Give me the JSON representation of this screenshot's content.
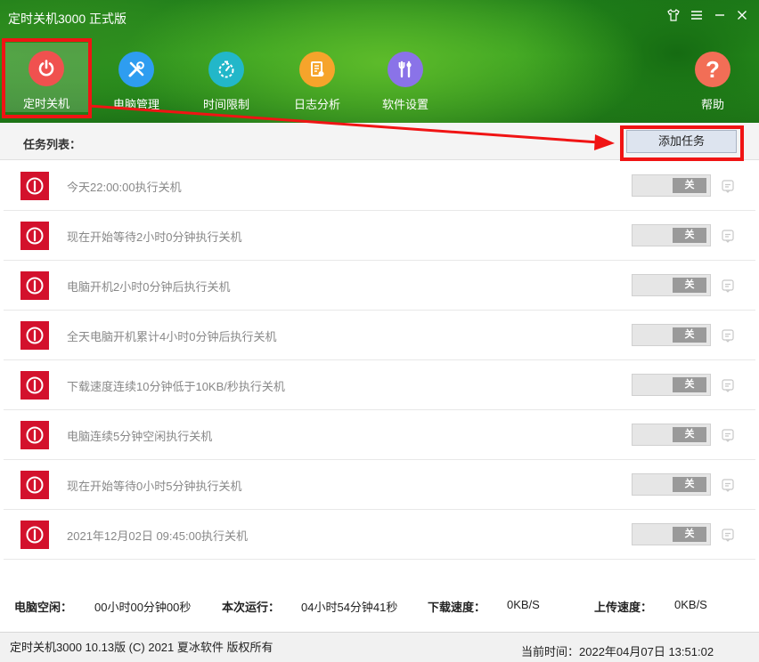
{
  "window": {
    "title": "定时关机3000 正式版",
    "controls": [
      "shirt-icon",
      "menu-icon",
      "minimize-icon",
      "close-icon"
    ]
  },
  "nav": {
    "items": [
      {
        "label": "定时关机",
        "icon": "power-icon",
        "color": "#f0514f",
        "active": true
      },
      {
        "label": "电脑管理",
        "icon": "tools-icon",
        "color": "#2e9df0"
      },
      {
        "label": "时间限制",
        "icon": "stopwatch-icon",
        "color": "#22b7c9"
      },
      {
        "label": "日志分析",
        "icon": "log-icon",
        "color": "#f6a42b"
      },
      {
        "label": "软件设置",
        "icon": "settings-icon",
        "color": "#8a73e8"
      }
    ],
    "help": {
      "label": "帮助",
      "icon": "help-icon",
      "color": "#f26e56"
    }
  },
  "task_list": {
    "title": "任务列表：",
    "add_button": "添加任务",
    "toggle_label": "关",
    "tasks": [
      "今天22:00:00执行关机",
      "现在开始等待2小时0分钟执行关机",
      "电脑开机2小时0分钟后执行关机",
      "全天电脑开机累计4小时0分钟后执行关机",
      "下载速度连续10分钟低于10KB/秒执行关机",
      "电脑连续5分钟空闲执行关机",
      "现在开始等待0小时5分钟执行关机",
      "2021年12月02日 09:45:00执行关机"
    ]
  },
  "status": {
    "idle_label": "电脑空闲：",
    "idle_value": "00小时00分钟00秒",
    "run_label": "本次运行：",
    "run_value": "04小时54分钟41秒",
    "download_label": "下载速度：",
    "download_value": "0KB/S",
    "upload_label": "上传速度：",
    "upload_value": "0KB/S"
  },
  "footer": {
    "copyright": "定时关机3000 10.13版 (C) 2021  夏冰软件 版权所有",
    "current_time": "当前时间：2022年04月07日 13:51:02"
  },
  "colors": {
    "accent_red": "#f01414",
    "task_icon_red": "#d3112c",
    "header_green": "#2f9a1f"
  }
}
